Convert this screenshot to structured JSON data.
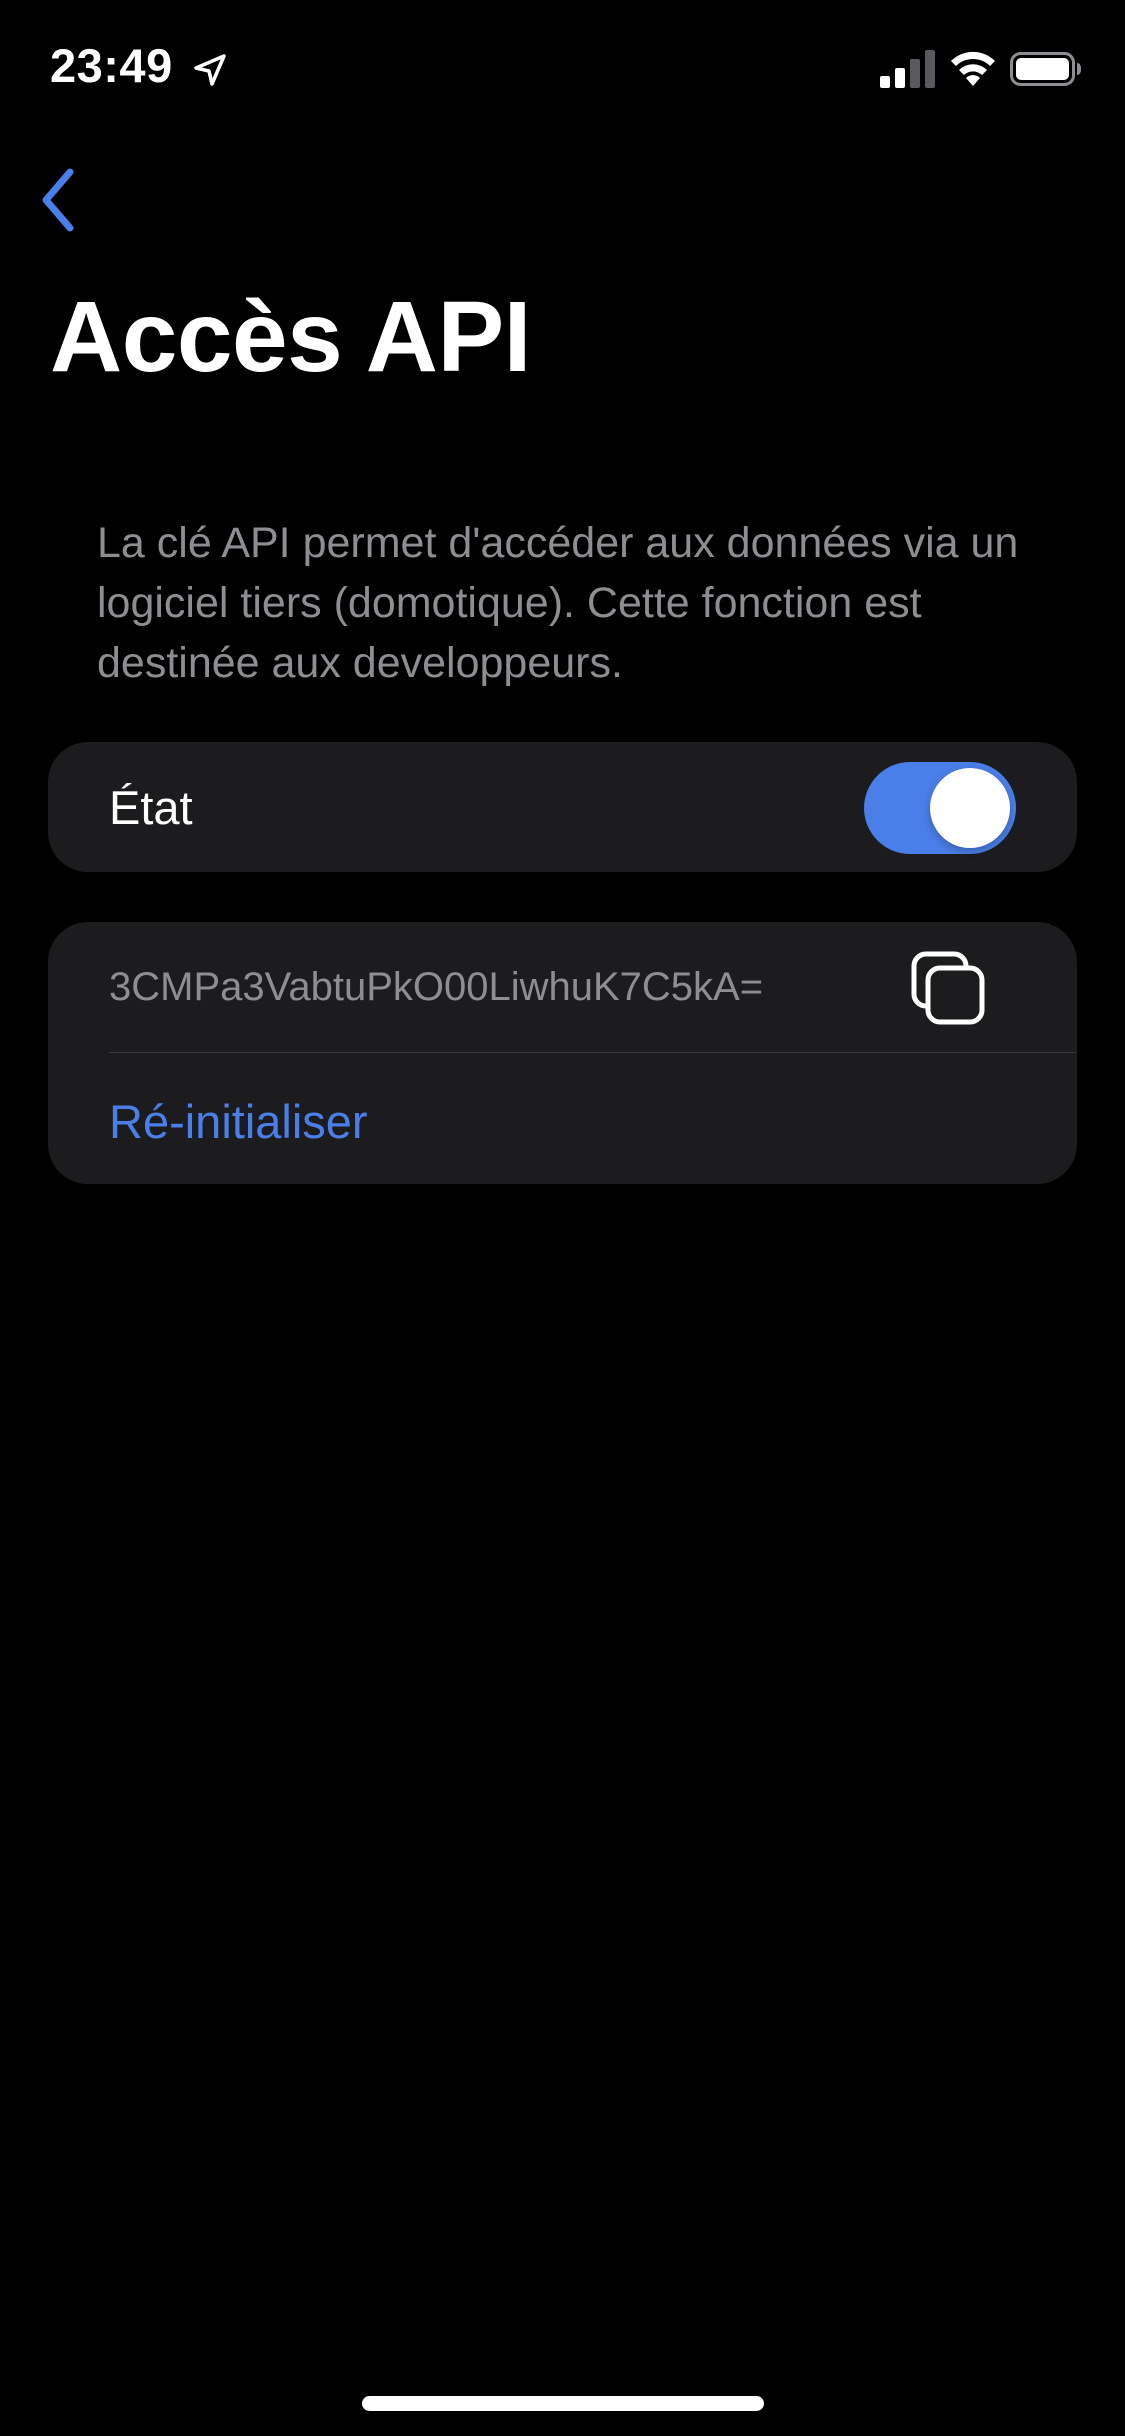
{
  "status_bar": {
    "time": "23:49",
    "icons": [
      "location-arrow-icon",
      "cellular-signal-icon",
      "wifi-icon",
      "battery-icon"
    ]
  },
  "nav": {
    "back_icon": "chevron-left-icon"
  },
  "page": {
    "title": "Accès API",
    "description": "La clé API permet d'accéder aux données via un logiciel tiers (domotique). Cette fonction est destinée aux developpeurs."
  },
  "state_card": {
    "label": "État",
    "toggle_on": true
  },
  "key_card": {
    "api_key": "3CMPa3VabtuPkO00LiwhuK7C5kA=",
    "copy_icon": "copy-icon",
    "reset_label": "Ré-initialiser"
  },
  "colors": {
    "background": "#000000",
    "card": "#1c1c1e",
    "accent": "#4a7ee8",
    "secondary_text": "#8d8d92"
  }
}
